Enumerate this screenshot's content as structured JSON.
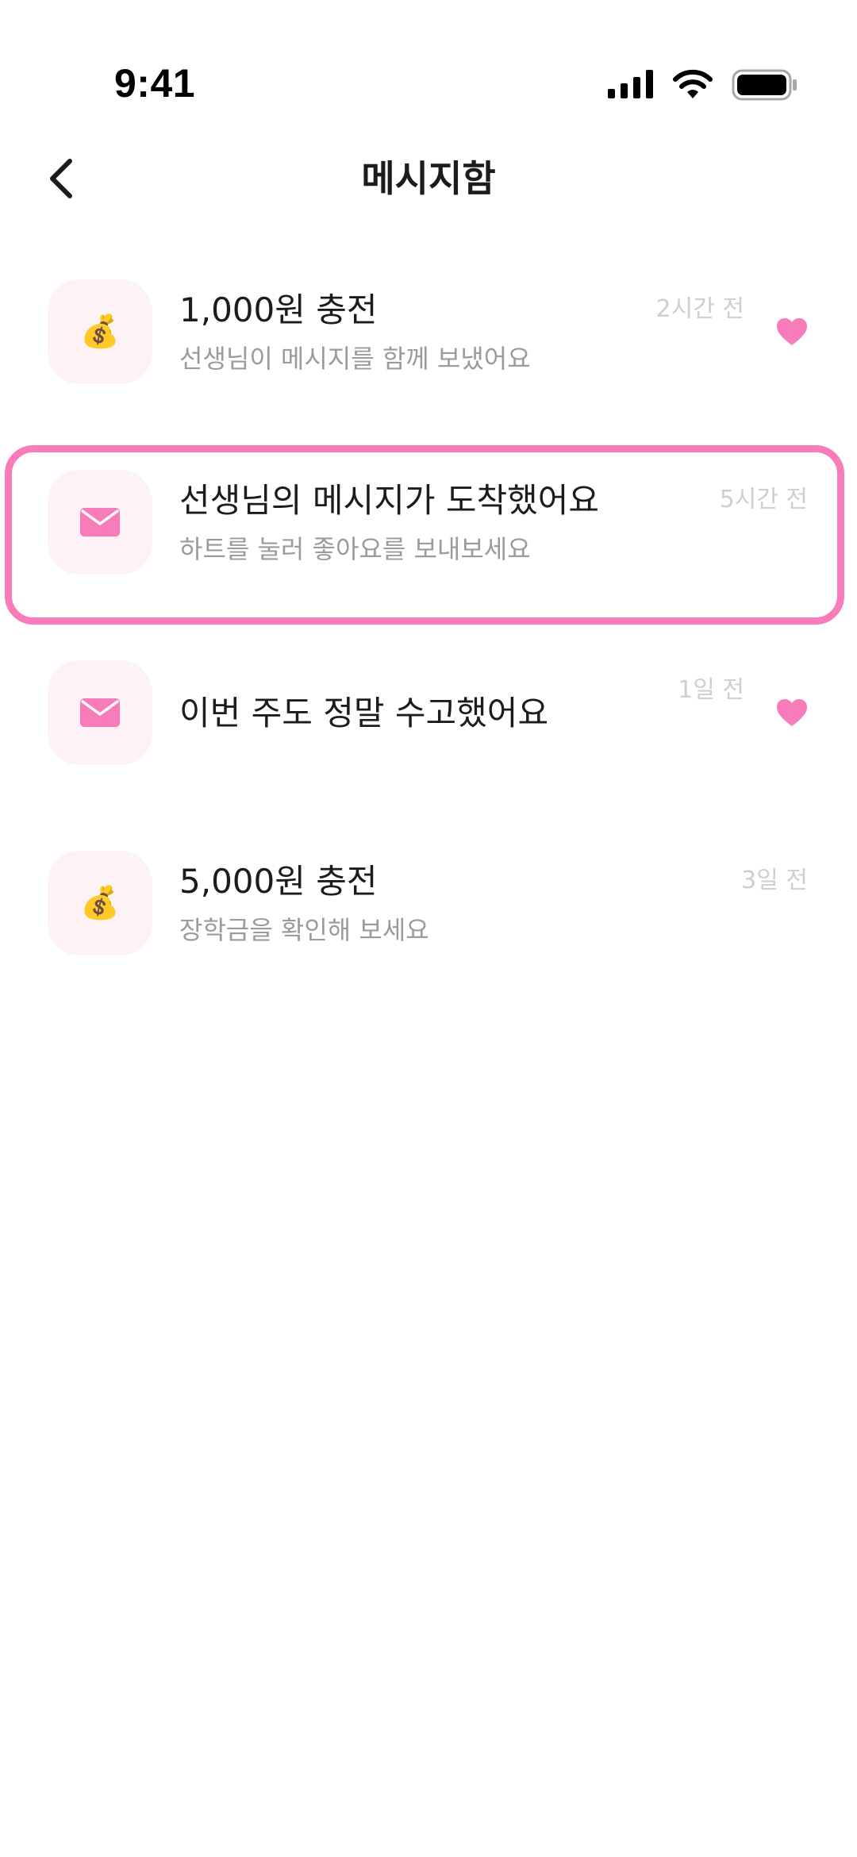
{
  "status_bar": {
    "time": "9:41",
    "icons": [
      "signal-icon",
      "wifi-icon",
      "battery-icon"
    ]
  },
  "header": {
    "title": "메시지함",
    "back_icon": "chevron-left-icon"
  },
  "colors": {
    "accent": "#f97cba",
    "icon_bg": "#fdf3f6",
    "subtitle": "#9b9b9f",
    "timestamp": "#cfcfd3"
  },
  "messages": [
    {
      "icon": "money-bag-icon",
      "title": "1,000원 충전",
      "subtitle": "선생님이 메시지를 함께 보냈어요",
      "time": "2시간 전",
      "liked": true,
      "highlighted": false
    },
    {
      "icon": "envelope-icon",
      "title": "선생님의 메시지가 도착했어요",
      "subtitle": "하트를 눌러 좋아요를 보내보세요",
      "time": "5시간 전",
      "liked": false,
      "highlighted": true
    },
    {
      "icon": "envelope-icon",
      "title": "이번 주도 정말 수고했어요",
      "subtitle": "",
      "time": "1일 전",
      "liked": true,
      "highlighted": false
    },
    {
      "icon": "money-bag-icon",
      "title": "5,000원 충전",
      "subtitle": "장학금을 확인해 보세요",
      "time": "3일 전",
      "liked": false,
      "highlighted": false
    }
  ]
}
